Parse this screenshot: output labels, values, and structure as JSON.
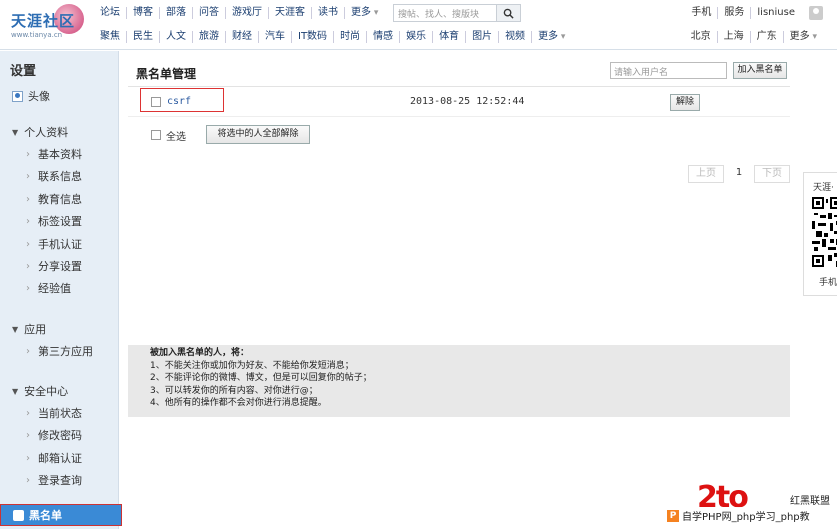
{
  "logo": {
    "text": "天涯社区",
    "url": "www.tianya.cn"
  },
  "nav_row1": [
    "论坛",
    "博客",
    "部落",
    "问答",
    "游戏厅",
    "天涯客",
    "读书",
    "更多"
  ],
  "nav_row2": [
    "聚焦",
    "民生",
    "人文",
    "旅游",
    "财经",
    "汽车",
    "IT数码",
    "时尚",
    "情感",
    "娱乐",
    "体育",
    "图片",
    "视频",
    "更多"
  ],
  "search": {
    "placeholder": "搜帖、找人、搜版块"
  },
  "right_row1": [
    "手机",
    "服务",
    "lisniuse"
  ],
  "right_row2": [
    "北京",
    "上海",
    "广东",
    "更多"
  ],
  "sidebar": {
    "title": "设置",
    "avatar_label": "头像",
    "groups": [
      {
        "label": "个人资料",
        "items": [
          "基本资料",
          "联系信息",
          "教育信息",
          "标签设置",
          "手机认证",
          "分享设置",
          "经验值"
        ]
      },
      {
        "label": "应用",
        "items": [
          "第三方应用"
        ]
      },
      {
        "label": "安全中心",
        "items": [
          "当前状态",
          "修改密码",
          "邮箱认证",
          "登录查询"
        ]
      }
    ],
    "active_label": "黑名单"
  },
  "main": {
    "title": "黑名单管理",
    "user_input_placeholder": "请输入用户名",
    "add_button": "加入黑名单",
    "rows": [
      {
        "name": "csrf",
        "time": "2013-08-25 12:52:44",
        "action": "解除"
      }
    ],
    "select_all": "全选",
    "remove_selected": "将选中的人全部解除",
    "pager": {
      "prev": "上页",
      "current": "1",
      "next": "下页"
    },
    "notice_title": "被加入黑名单的人，将：",
    "notice_lines": [
      "1、不能关注你或加你为好友、不能给你发短消息；",
      "2、不能评论你的微博、博文，但是可以回复你的帖子；",
      "3、可以转发你的所有内容、对你进行@；",
      "4、他所有的操作都不会对你进行消息提醒。"
    ]
  },
  "qr_panel": {
    "title": "天涯·",
    "caption": "手机"
  },
  "watermark": {
    "big": "2to",
    "tag": "红黑联盟",
    "bar": "自学PHP网_php学习_php教"
  }
}
